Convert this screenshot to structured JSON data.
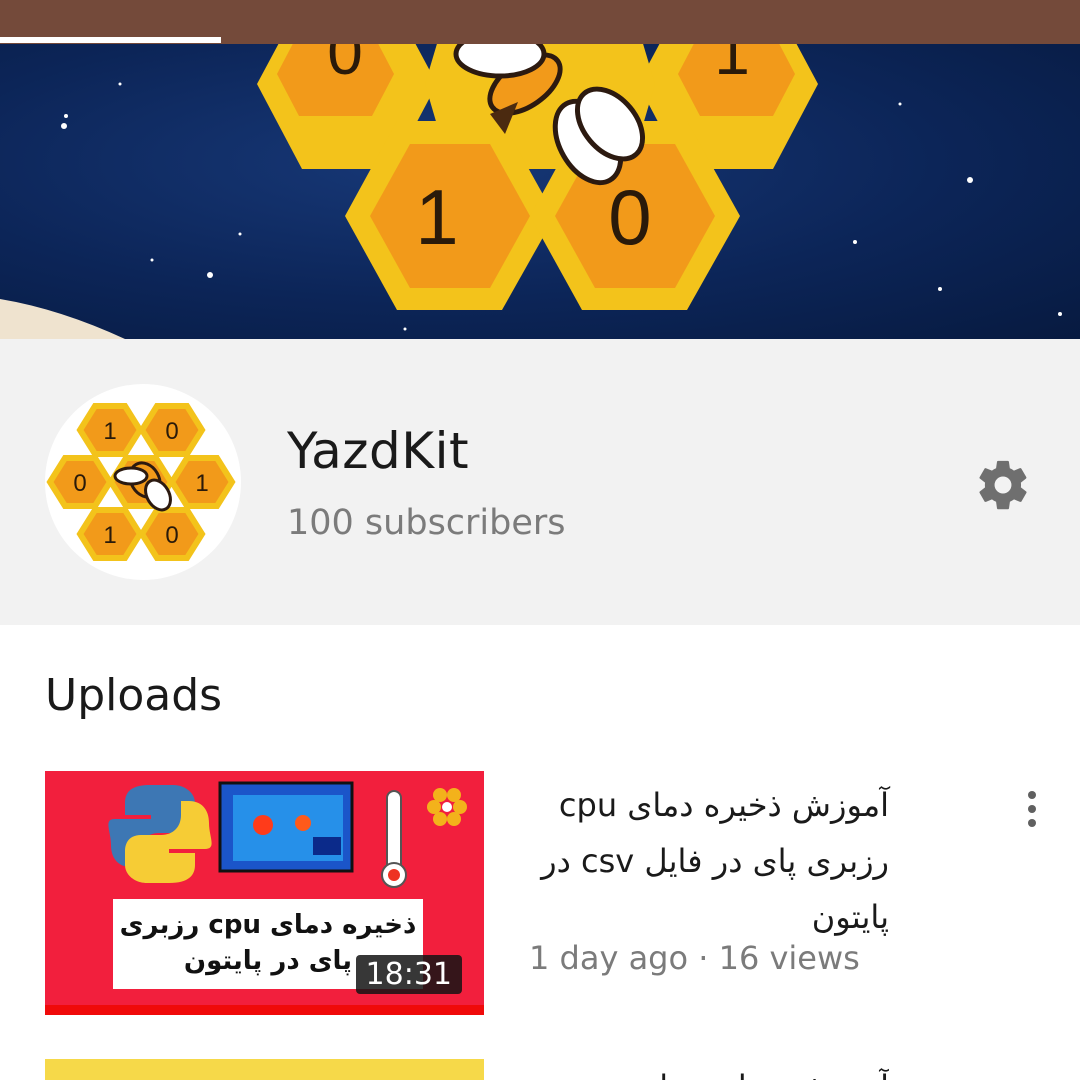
{
  "banner": {
    "hex_digits": [
      "0",
      "1",
      "1",
      "0"
    ]
  },
  "channel": {
    "name": "YazdKit",
    "subscribers": "100 subscribers",
    "avatar_digits": [
      "1",
      "0",
      "0",
      "1",
      "1",
      "0"
    ]
  },
  "uploads": {
    "section_title": "Uploads",
    "videos": [
      {
        "title": "آموزش ذخیره دمای cpu رزبری پای در فایل csv در پایتون",
        "thumbnail_caption": "ذخیره دمای cpu رزبری پای در پایتون",
        "duration": "18:31",
        "meta": "1 day ago · 16 views"
      },
      {
        "title": "آموزش تنظیم ساعت سیستم"
      }
    ]
  },
  "icons": {
    "settings": "gear-icon",
    "menu": "kebab-menu-icon"
  },
  "colors": {
    "top_bar": "#744a3a",
    "header_bg": "#f2f2f2",
    "honey": "#f2b51c",
    "thumbnail_red": "#f21f3d"
  }
}
